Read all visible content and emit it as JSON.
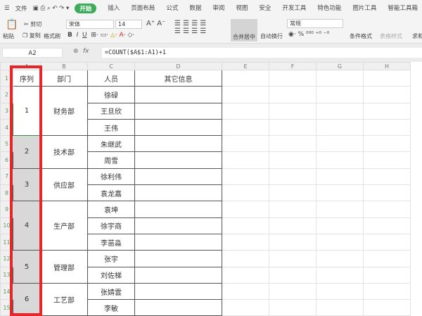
{
  "menu": {
    "file": "文件",
    "tabs": [
      "开始",
      "插入",
      "页面布局",
      "公式",
      "数据",
      "审阅",
      "视图",
      "安全",
      "开发工具",
      "特色功能",
      "图片工具",
      "智能工具箱"
    ]
  },
  "ribbon": {
    "paste": "粘贴",
    "cut": "剪切",
    "copy": "复制",
    "format_painter": "格式刷",
    "font": "宋体",
    "size": "14",
    "merge": "合并居中",
    "wrap": "自动换行",
    "number_format": "常规",
    "cond_format": "条件格式",
    "table_style": "表格样式",
    "sum": "求和"
  },
  "formula_bar": {
    "name_box": "A2",
    "fx": "fx",
    "formula": "=COUNT($A$1:A1)+1"
  },
  "columns": [
    "A",
    "B",
    "C",
    "D",
    "E",
    "F",
    "G",
    "H"
  ],
  "headers": [
    "序列",
    "部门",
    "人员",
    "其它信息"
  ],
  "groups": [
    {
      "seq": "1",
      "dept": "财务部",
      "people": [
        "徐碌",
        "王旦欣",
        "王伟"
      ]
    },
    {
      "seq": "2",
      "dept": "技术部",
      "people": [
        "朱继武",
        "周雪"
      ]
    },
    {
      "seq": "3",
      "dept": "供应部",
      "people": [
        "徐利伟",
        "袁龙嘉"
      ]
    },
    {
      "seq": "4",
      "dept": "生产部",
      "people": [
        "袁坤",
        "徐宇商",
        "李苗淼"
      ]
    },
    {
      "seq": "5",
      "dept": "管理部",
      "people": [
        "张宇",
        "刘佐梯"
      ]
    },
    {
      "seq": "6",
      "dept": "工艺部",
      "people": [
        "张婧雲",
        "李敏"
      ]
    }
  ],
  "colors": {
    "accent": "#3cab5a",
    "highlight": "#e8262a"
  }
}
